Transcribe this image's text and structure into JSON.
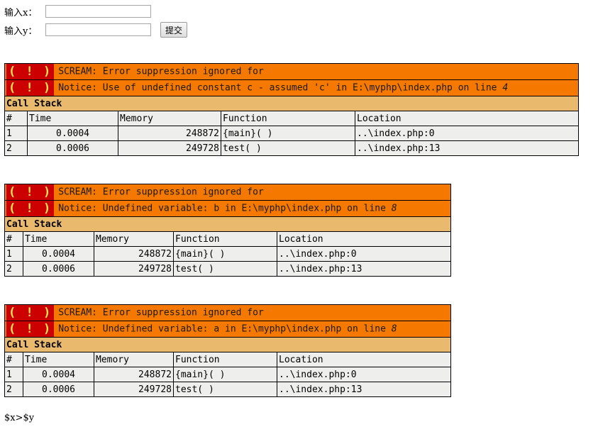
{
  "form": {
    "x_label": "输入x：",
    "y_label": "输入y：",
    "x_value": "",
    "y_value": "",
    "submit_label": "提交"
  },
  "errors": [
    {
      "icon": "( ! )",
      "scream_text": "SCREAM: Error suppression ignored for",
      "notice_text": "Notice: Use of undefined constant c - assumed 'c' in E:\\myphp\\index.php on line ",
      "notice_line": "4",
      "call_stack_title": "Call Stack",
      "columns": [
        "#",
        "Time",
        "Memory",
        "Function",
        "Location"
      ],
      "rows": [
        {
          "num": "1",
          "time": "0.0004",
          "memory": "248872",
          "function": "{main}( )",
          "location": "..\\index.php:0"
        },
        {
          "num": "2",
          "time": "0.0006",
          "memory": "249728",
          "function": "test( )",
          "location": "..\\index.php:13"
        }
      ]
    },
    {
      "icon": "( ! )",
      "scream_text": "SCREAM: Error suppression ignored for",
      "notice_text": "Notice: Undefined variable: b in E:\\myphp\\index.php on line ",
      "notice_line": "8",
      "call_stack_title": "Call Stack",
      "columns": [
        "#",
        "Time",
        "Memory",
        "Function",
        "Location"
      ],
      "rows": [
        {
          "num": "1",
          "time": "0.0004",
          "memory": "248872",
          "function": "{main}( )",
          "location": "..\\index.php:0"
        },
        {
          "num": "2",
          "time": "0.0006",
          "memory": "249728",
          "function": "test( )",
          "location": "..\\index.php:13"
        }
      ]
    },
    {
      "icon": "( ! )",
      "scream_text": "SCREAM: Error suppression ignored for",
      "notice_text": "Notice: Undefined variable: a in E:\\myphp\\index.php on line ",
      "notice_line": "8",
      "call_stack_title": "Call Stack",
      "columns": [
        "#",
        "Time",
        "Memory",
        "Function",
        "Location"
      ],
      "rows": [
        {
          "num": "1",
          "time": "0.0004",
          "memory": "248872",
          "function": "{main}( )",
          "location": "..\\index.php:0"
        },
        {
          "num": "2",
          "time": "0.0006",
          "memory": "249728",
          "function": "test( )",
          "location": "..\\index.php:13"
        }
      ]
    }
  ],
  "result_text": "$x>$y",
  "colors": {
    "error_header": "#f57900",
    "icon_bg": "#cc0000",
    "icon_fg": "#fce94f",
    "call_stack_bg": "#e9b96e",
    "row_bg": "#eeeeec"
  }
}
